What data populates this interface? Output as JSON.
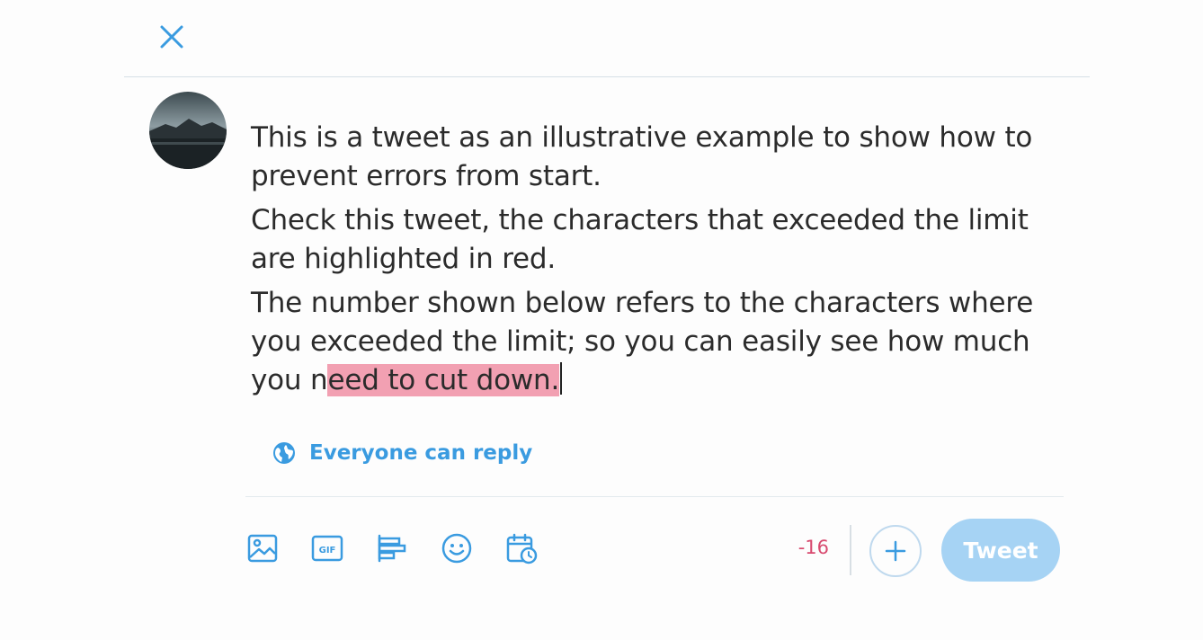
{
  "compose": {
    "paragraphs": [
      "This is a tweet as an illustrative example to show how to prevent errors from start.",
      "Check this tweet, the characters that exceeded the limit are highlighted in red."
    ],
    "last_paragraph_within_limit": "The number shown below refers to the characters where you exceeded the limit; so you can easily see how much you n",
    "last_paragraph_over_limit": "eed to cut down."
  },
  "reply_setting": {
    "label": "Everyone can reply",
    "icon": "globe-icon"
  },
  "toolbar": {
    "icons": [
      "image-icon",
      "gif-icon",
      "poll-icon",
      "emoji-icon",
      "schedule-icon"
    ],
    "gif_text": "GIF"
  },
  "counter": {
    "remaining": "-16"
  },
  "actions": {
    "tweet_label": "Tweet",
    "add_icon": "plus-icon",
    "close_icon": "close-icon"
  },
  "colors": {
    "accent": "#3a9be0",
    "over_limit_highlight": "#f2a0b2",
    "counter_negative": "#d84a6f",
    "tweet_button_disabled": "#a6d3f4"
  }
}
